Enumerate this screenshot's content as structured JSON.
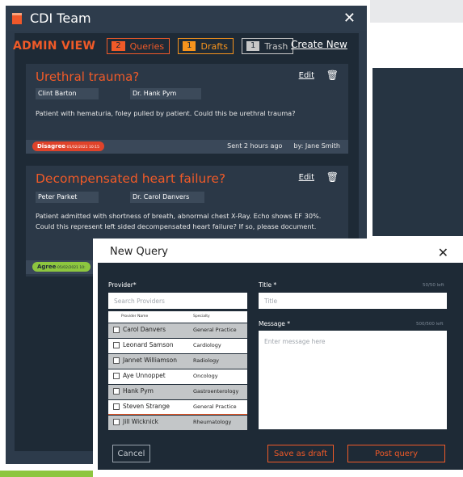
{
  "window": {
    "title": "CDI Team"
  },
  "toolbar": {
    "admin_view": "ADMIN VIEW",
    "queries": {
      "count": "2",
      "label": "Queries"
    },
    "drafts": {
      "count": "1",
      "label": "Drafts"
    },
    "trash": {
      "count": "1",
      "label": "Trash"
    },
    "create_new": "Create New"
  },
  "cards": [
    {
      "title": "Urethral trauma?",
      "edit": "Edit",
      "tags": [
        "Clint Barton",
        "Dr. Hank Pym"
      ],
      "text": "Patient with hematuria, foley pulled by patient. Could this be urethral trauma?",
      "status": "Disagree",
      "status_date": "-05/02/2021 10:15",
      "sent": "Sent 2 hours ago",
      "by": "by: Jane Smith"
    },
    {
      "title": "Decompensated heart failure?",
      "edit": "Edit",
      "tags": [
        "Peter Parket",
        "Dr. Carol Danvers"
      ],
      "text": "Patient admitted with shortness of breath, abnormal chest X-Ray. Echo shows EF 30%. Could this represent left sided decompensated heart failure? If so, please document.",
      "status": "Agree",
      "status_date": "-05/02/2021 10:"
    }
  ],
  "modal": {
    "title": "New Query",
    "provider_label": "Provider*",
    "search_placeholder": "Search Providers",
    "col_name": "Provider Name",
    "col_specialty": "Specialty",
    "providers": [
      {
        "name": "Carol Danvers",
        "specialty": "General Practice"
      },
      {
        "name": "Leonard Samson",
        "specialty": "Cardiology"
      },
      {
        "name": "Jannet Williamson",
        "specialty": "Radiology"
      },
      {
        "name": "Aye Unnoppet",
        "specialty": "Oncology"
      },
      {
        "name": "Hank Pym",
        "specialty": "Gastroenterology"
      },
      {
        "name": "Steven Strange",
        "specialty": "General Practice"
      },
      {
        "name": "Jill Wicknick",
        "specialty": "Rheumatology"
      }
    ],
    "title_label": "Title *",
    "title_counter": "50/50 left",
    "title_placeholder": "Title",
    "message_label": "Message *",
    "message_counter": "500/500 left",
    "message_placeholder": "Enter message here",
    "cancel": "Cancel",
    "save_draft": "Save as draft",
    "post": "Post query"
  },
  "colors": {
    "accent": "#f05a28",
    "drafts": "#f7941d",
    "agree": "#8dc63f",
    "disagree": "#e0432a",
    "panel": "#1e2a36"
  }
}
